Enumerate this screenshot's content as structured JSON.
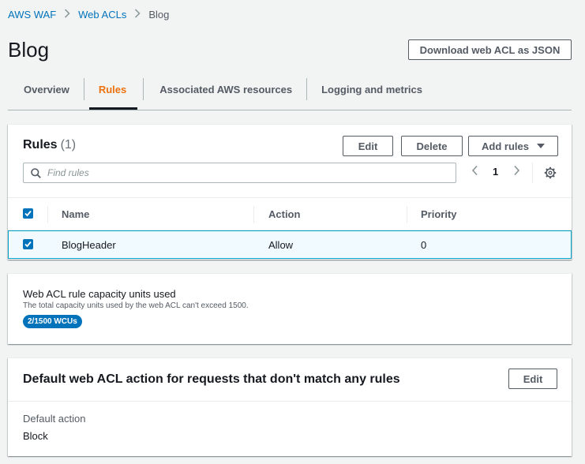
{
  "breadcrumb": {
    "items": [
      "AWS WAF",
      "Web ACLs",
      "Blog"
    ]
  },
  "page": {
    "title": "Blog",
    "download_label": "Download web ACL as JSON"
  },
  "tabs": [
    {
      "label": "Overview",
      "active": false
    },
    {
      "label": "Rules",
      "active": true
    },
    {
      "label": "Associated AWS resources",
      "active": false
    },
    {
      "label": "Logging and metrics",
      "active": false
    }
  ],
  "rules_panel": {
    "title": "Rules",
    "count": "(1)",
    "edit_label": "Edit",
    "delete_label": "Delete",
    "add_rules_label": "Add rules",
    "search_placeholder": "Find rules",
    "page_number": "1",
    "columns": [
      "Name",
      "Action",
      "Priority"
    ],
    "rows": [
      {
        "name": "BlogHeader",
        "action": "Allow",
        "priority": "0",
        "selected": true
      }
    ]
  },
  "capacity_panel": {
    "title": "Web ACL rule capacity units used",
    "description": "The total capacity units used by the web ACL can't exceed 1500.",
    "badge": "2/1500 WCUs"
  },
  "default_panel": {
    "title": "Default web ACL action for requests that don't match any rules",
    "edit_label": "Edit",
    "label": "Default action",
    "value": "Block"
  },
  "colors": {
    "link": "#0073bb",
    "active_tab": "#ec7211",
    "selected_row_bg": "#f1faff",
    "selected_row_border": "#00a1c9",
    "badge": "#0073bb"
  }
}
